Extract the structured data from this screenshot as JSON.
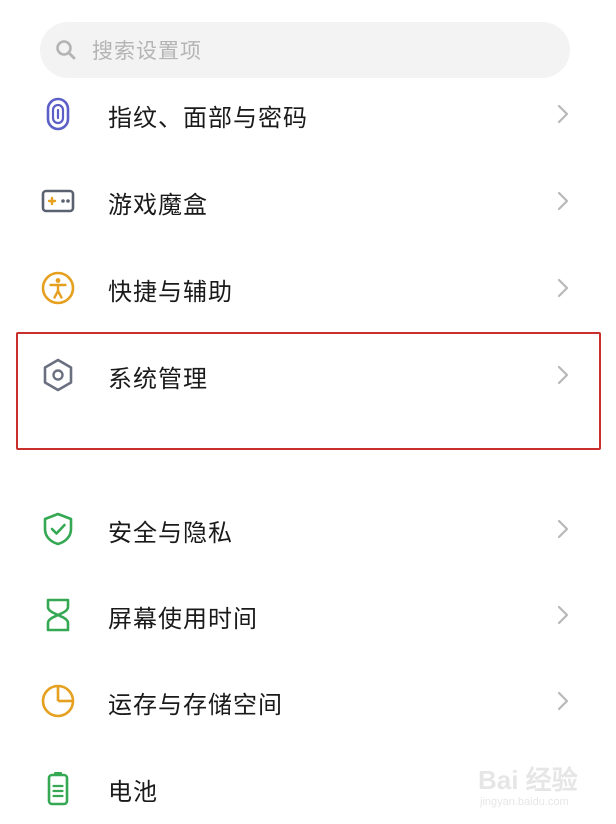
{
  "search": {
    "placeholder": "搜索设置项",
    "icon": "search-icon"
  },
  "settings": {
    "items": [
      {
        "label": "指纹、面部与密码",
        "icon": "fingerprint-icon",
        "color": "#5b5fc7"
      },
      {
        "label": "游戏魔盒",
        "icon": "gamepad-icon",
        "color": "#5a6272"
      },
      {
        "label": "快捷与辅助",
        "icon": "accessibility-icon",
        "color": "#e6a020"
      },
      {
        "label": "系统管理",
        "icon": "hexagon-settings-icon",
        "color": "#6a7080"
      },
      {
        "label": "安全与隐私",
        "icon": "shield-check-icon",
        "color": "#34a853"
      },
      {
        "label": "屏幕使用时间",
        "icon": "hourglass-icon",
        "color": "#34a853"
      },
      {
        "label": "运存与存储空间",
        "icon": "pie-chart-icon",
        "color": "#e6a020"
      },
      {
        "label": "电池",
        "icon": "battery-icon",
        "color": "#34a853"
      }
    ],
    "chevron_icon": "chevron-right-icon"
  },
  "highlight": {
    "color": "#c9302c"
  },
  "watermark": {
    "text": "Bai 经验",
    "sub": "jingyan.baidu.com"
  }
}
